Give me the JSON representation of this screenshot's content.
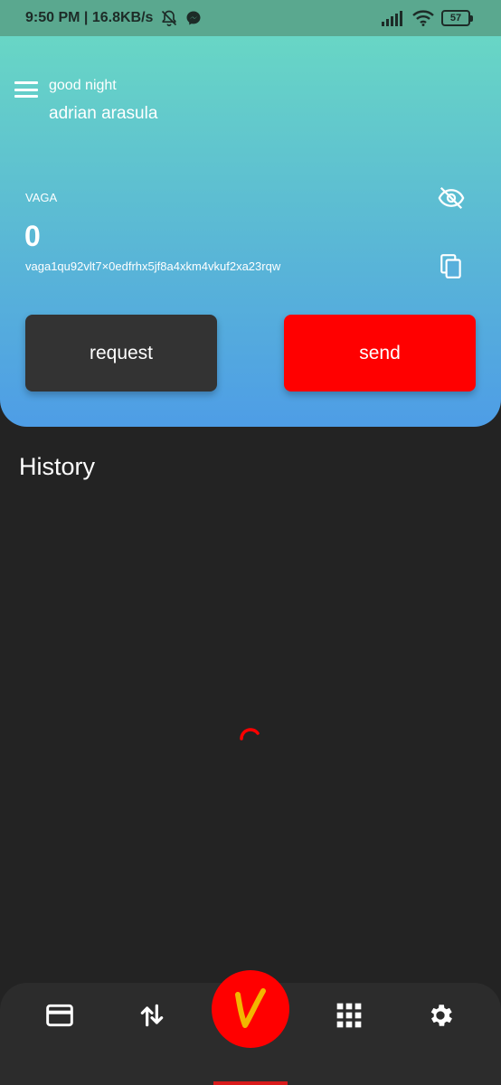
{
  "status_bar": {
    "time_speed": "9:50 PM | 16.8KB/s",
    "battery": "57"
  },
  "header": {
    "greeting": "good night",
    "username": "adrian arasula",
    "token_label": "VAGA",
    "balance": "0",
    "address": "vaga1qu92vlt7×0edfrhx5jf8a4xkm4vkuf2xa23rqw"
  },
  "actions": {
    "request_label": "request",
    "send_label": "send"
  },
  "history": {
    "title": "History"
  },
  "icons": {
    "menu": "hamburger-menu-icon",
    "eye": "eye-off-icon",
    "copy": "copy-icon",
    "wallet": "credit-card-icon",
    "transfer": "swap-vertical-icon",
    "logo": "vaga-logo-icon",
    "apps": "grid-icon",
    "settings": "gear-icon"
  },
  "colors": {
    "accent_red": "#ff0000",
    "dark_button": "#333333",
    "background": "#232323",
    "gradient_top": "#68d6c5",
    "gradient_bottom": "#4e9de6"
  }
}
